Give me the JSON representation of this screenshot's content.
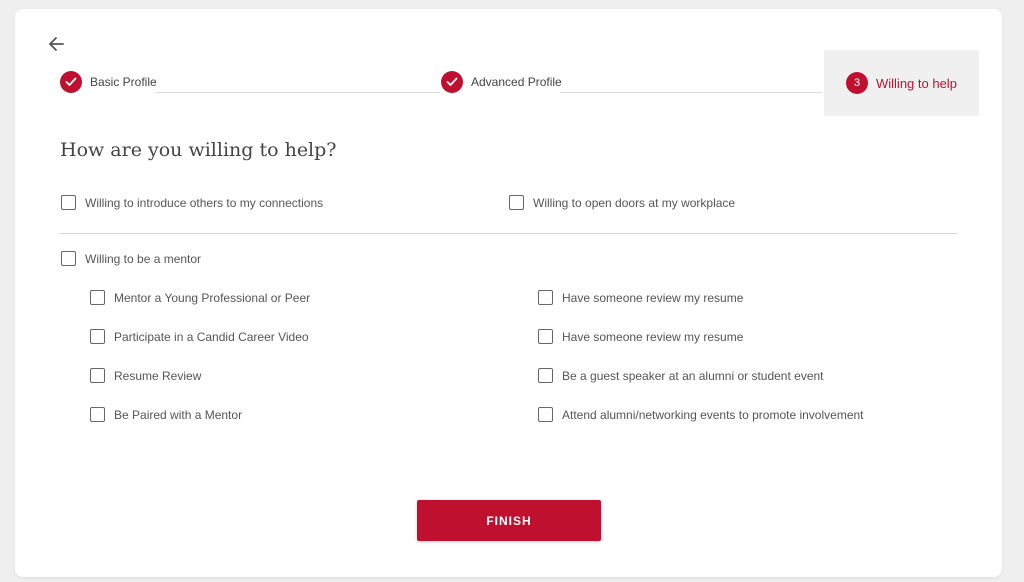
{
  "stepper": {
    "steps": [
      {
        "label": "Basic Profile",
        "status": "complete",
        "marker": "check-icon"
      },
      {
        "label": "Advanced Profile",
        "status": "complete",
        "marker": "check-icon"
      },
      {
        "label": "Willing to help",
        "status": "active",
        "number": "3"
      }
    ]
  },
  "question": "How are you willing to help?",
  "options": {
    "top": [
      {
        "label": "Willing to introduce others to my connections",
        "checked": false
      },
      {
        "label": "Willing to open doors at my workplace",
        "checked": false
      }
    ],
    "mentor": {
      "label": "Willing to be a mentor",
      "checked": false
    },
    "sub_left": [
      {
        "label": "Mentor a Young Professional or Peer",
        "checked": false
      },
      {
        "label": "Participate in a Candid Career Video",
        "checked": false
      },
      {
        "label": "Resume Review",
        "checked": false
      },
      {
        "label": "Be Paired with a Mentor",
        "checked": false
      }
    ],
    "sub_right": [
      {
        "label": "Have someone review my resume",
        "checked": false
      },
      {
        "label": "Have someone review my resume",
        "checked": false
      },
      {
        "label": "Be a guest speaker at an alumni or student event",
        "checked": false
      },
      {
        "label": "Attend alumni/networking events to promote involvement",
        "checked": false
      }
    ]
  },
  "finish_label": "FINISH",
  "colors": {
    "accent": "#c0102f",
    "background": "#efefef",
    "card": "#ffffff"
  },
  "icons": {
    "back": "arrow-left-icon"
  }
}
